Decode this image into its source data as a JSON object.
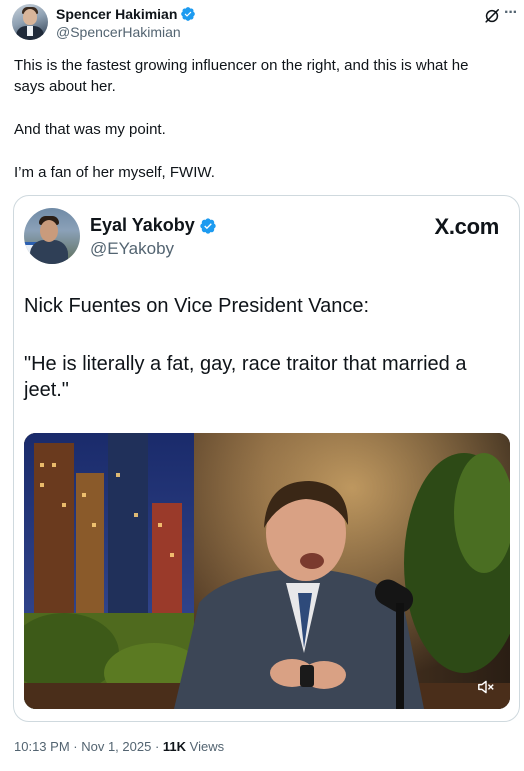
{
  "author": {
    "display_name": "Spencer Hakimian",
    "handle": "@SpencerHakimian"
  },
  "tweet": {
    "lines": [
      "This is the fastest growing influencer on the right, and this is what he",
      "says about her.",
      "And that was my point.",
      "I’m a fan of her myself, FWIW."
    ]
  },
  "quoted": {
    "display_name": "Eyal Yakoby",
    "handle": "@EYakoby",
    "watermark": "X.com",
    "text_lines": [
      "Nick Fuentes on Vice President Vance:",
      "\"He is literally a fat, gay, race traitor that married a",
      "jeet.\""
    ]
  },
  "meta": {
    "time": "10:13 PM",
    "sep1": " · ",
    "date": "Nov 1, 2025",
    "sep2": " · ",
    "views_count": "11K",
    "views_label": " Views"
  },
  "colors": {
    "text": "#0f1419",
    "secondary": "#536471",
    "verified": "#1d9bf0",
    "border": "#cfd9de"
  },
  "icons": {
    "verified": "verified-badge-icon",
    "grok": "grok-icon",
    "more": "more-icon",
    "mute": "volume-muted-icon"
  }
}
